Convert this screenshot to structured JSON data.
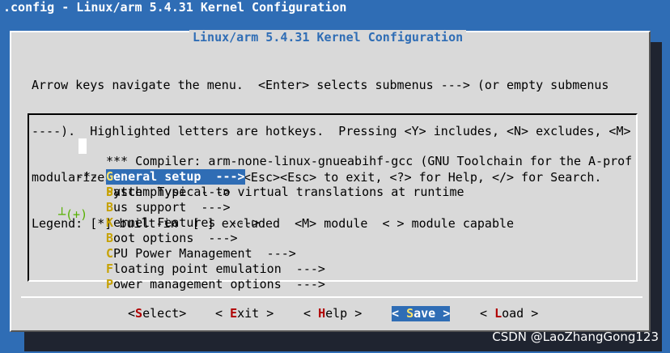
{
  "window": {
    "title": ".config - Linux/arm 5.4.31 Kernel Configuration"
  },
  "dialog": {
    "title": "Linux/arm 5.4.31 Kernel Configuration"
  },
  "help_lines": [
    "Arrow keys navigate the menu.  <Enter> selects submenus ---> (or empty submenus",
    "----).  Highlighted letters are hotkeys.  Pressing <Y> includes, <N> excludes, <M>",
    "modularizes features.  Press <Esc><Esc> to exit, <?> for Help, </> for Search.",
    "Legend: [*] built-in  [ ] excluded  <M> module  < > module capable"
  ],
  "menu": {
    "items": [
      {
        "prefix": "",
        "hot": "",
        "rest": "*** Compiler: arm-none-linux-gnueabihf-gcc (GNU Toolchain for the A-prof"
      },
      {
        "prefix": "",
        "hot": "G",
        "rest": "eneral setup  --->",
        "selected": true
      },
      {
        "prefix": "-*-",
        "hot": "P",
        "rest": "atch physical to virtual translations at runtime"
      },
      {
        "prefix": "",
        "hot": "S",
        "rest": "ystem Type  --->"
      },
      {
        "prefix": "",
        "hot": "B",
        "rest": "us support  --->"
      },
      {
        "prefix": "",
        "hot": "K",
        "rest": "ernel Features  --->"
      },
      {
        "prefix": "",
        "hot": "B",
        "rest": "oot options  --->"
      },
      {
        "prefix": "",
        "hot": "C",
        "rest": "PU Power Management  --->"
      },
      {
        "prefix": "",
        "hot": "F",
        "rest": "loating point emulation  --->"
      },
      {
        "prefix": "",
        "hot": "P",
        "rest": "ower management options  --->"
      }
    ],
    "more_indicator": "┴(+)"
  },
  "buttons": {
    "select": {
      "pre": "<",
      "hot": "S",
      "rest": "elect>"
    },
    "exit": {
      "pre": "< ",
      "hot": "E",
      "rest": "xit >"
    },
    "help": {
      "pre": "< ",
      "hot": "H",
      "rest": "elp >"
    },
    "save": {
      "pre": "< ",
      "hot": "S",
      "rest": "ave >"
    },
    "load": {
      "pre": "< ",
      "hot": "L",
      "rest": "oad >"
    }
  },
  "watermark": "CSDN @LaoZhangGong123"
}
